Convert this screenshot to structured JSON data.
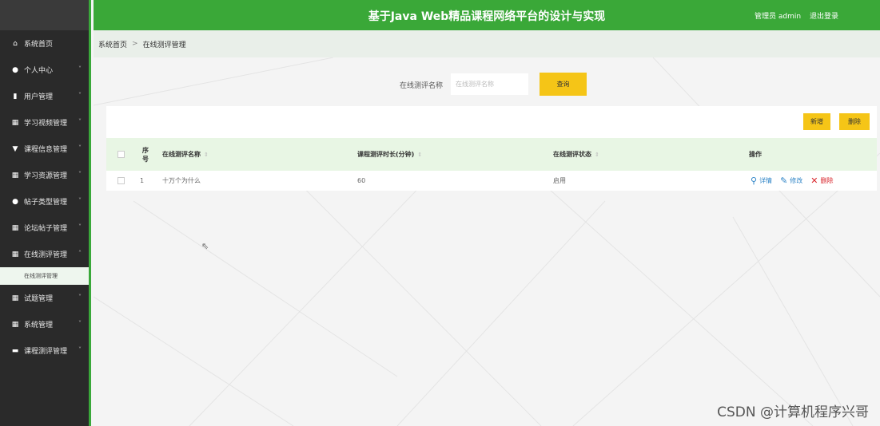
{
  "header": {
    "title": "基于Java Web精品课程网络平台的设计与实现",
    "user_label": "管理员 admin",
    "logout": "退出登录"
  },
  "sidebar": {
    "items": [
      {
        "label": "系统首页",
        "icon": "home-icon",
        "chevron": ""
      },
      {
        "label": "个人中心",
        "icon": "user-icon",
        "chevron": "˅"
      },
      {
        "label": "用户管理",
        "icon": "clipboard-icon",
        "chevron": "˅"
      },
      {
        "label": "学习视频管理",
        "icon": "grid-icon",
        "chevron": "˅"
      },
      {
        "label": "课程信息管理",
        "icon": "funnel-icon",
        "chevron": "˅"
      },
      {
        "label": "学习资源管理",
        "icon": "grid-icon",
        "chevron": "˅"
      },
      {
        "label": "帖子类型管理",
        "icon": "user-icon",
        "chevron": "˅"
      },
      {
        "label": "论坛帖子管理",
        "icon": "grid-icon",
        "chevron": "˅"
      },
      {
        "label": "在线测评管理",
        "icon": "grid-icon",
        "chevron": "˄"
      },
      {
        "label": "试题管理",
        "icon": "grid-icon",
        "chevron": "˅"
      },
      {
        "label": "系统管理",
        "icon": "grid-icon",
        "chevron": "˅"
      },
      {
        "label": "课程测评管理",
        "icon": "briefcase-icon",
        "chevron": "˅"
      }
    ],
    "active_sub": "在线测评管理"
  },
  "breadcrumb": {
    "home": "系统首页",
    "separator": ">",
    "current": "在线测评管理"
  },
  "search": {
    "label": "在线测评名称",
    "placeholder": "在线测评名称",
    "button": "查询"
  },
  "toolbar": {
    "add": "新增",
    "delete": "删除"
  },
  "table": {
    "columns": {
      "index": "序号",
      "name": "在线测评名称",
      "duration": "课程测评时长(分钟)",
      "status": "在线测评状态",
      "actions": "操作"
    },
    "sort_glyph": "⇕",
    "rows": [
      {
        "index": "1",
        "name": "十万个为什么",
        "duration": "60",
        "status": "启用"
      }
    ],
    "actions": {
      "view": "详情",
      "edit": "修改",
      "delete": "删除"
    }
  },
  "watermark": "CSDN @计算机程序兴哥",
  "colors": {
    "header_green": "#3aa838",
    "sidebar_dark": "#2a2a2a",
    "button_yellow": "#f5c517",
    "table_header_green": "#e8f6e4",
    "link_blue": "#2e84c7",
    "delete_red": "#d9262c"
  }
}
